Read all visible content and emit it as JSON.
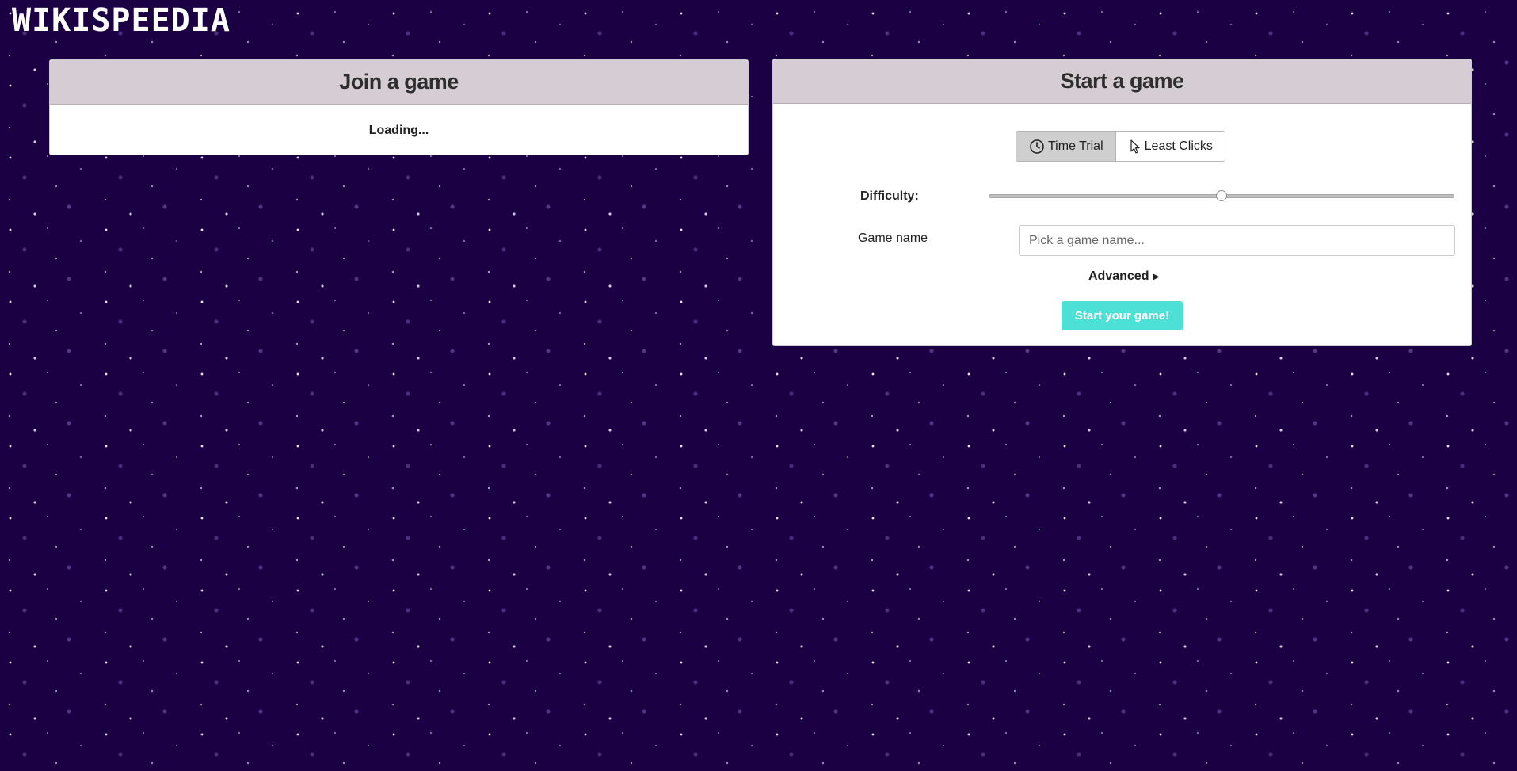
{
  "app": {
    "logo_text": "WIKISPEEDIA"
  },
  "join_panel": {
    "title": "Join a game",
    "status_text": "Loading..."
  },
  "start_panel": {
    "title": "Start a game",
    "modes": [
      {
        "label": "Time Trial",
        "icon": "clock-icon",
        "selected": true
      },
      {
        "label": "Least Clicks",
        "icon": "cursor-icon",
        "selected": false
      }
    ],
    "difficulty": {
      "label": "Difficulty:",
      "level_fraction": 0.5
    },
    "game_name": {
      "label": "Game name",
      "value": "",
      "placeholder": "Pick a game name..."
    },
    "advanced_label": "Advanced",
    "submit_label": "Start your game!"
  },
  "colors": {
    "background": "#1c0044",
    "panel_header": "#d5cdd3",
    "submit_button": "#4de0d6"
  }
}
